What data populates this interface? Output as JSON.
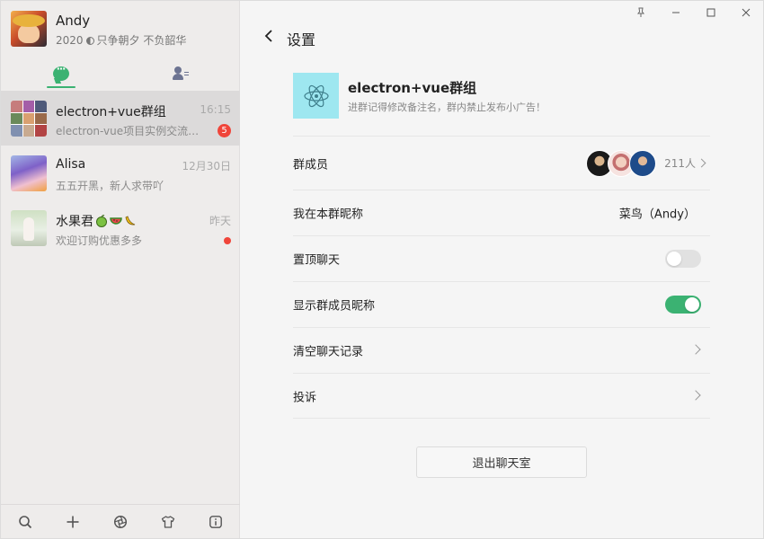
{
  "profile": {
    "name": "Andy",
    "motto_year": "2020",
    "motto_text": "只争朝夕 不负韶华"
  },
  "colors": {
    "accent": "#3bb272",
    "badge": "#f0453a",
    "group_logo_bg": "#9ee7f0"
  },
  "tabs": [
    {
      "icon": "chat-bubble-icon",
      "active": true
    },
    {
      "icon": "contacts-icon",
      "active": false
    }
  ],
  "chats": [
    {
      "title": "electron+vue群组",
      "preview": "electron-vue项目实例交流群…",
      "time": "16:15",
      "unread": "5",
      "active": true
    },
    {
      "title": "Alisa",
      "preview": "五五开黑，新人求带吖",
      "time": "12月30日"
    },
    {
      "title": "水果君",
      "preview": "欢迎订购优惠多多",
      "time": "昨天",
      "dot": true
    }
  ],
  "bottom_bar": [
    "search-icon",
    "plus-icon",
    "aperture-icon",
    "tshirt-icon",
    "info-icon"
  ],
  "window_controls": [
    "pin-icon",
    "minimize-icon",
    "maximize-icon",
    "close-icon"
  ],
  "header": {
    "title": "设置"
  },
  "group": {
    "name": "electron+vue群组",
    "notice": "进群记得修改备注名，群内禁止发布小广告！"
  },
  "settings": {
    "members": {
      "label": "群成员",
      "count": "211人"
    },
    "nickname": {
      "label": "我在本群昵称",
      "value": "菜鸟（Andy）"
    },
    "pin_chat": {
      "label": "置顶聊天",
      "on": false
    },
    "show_nicknames": {
      "label": "显示群成员昵称",
      "on": true
    },
    "clear_history": {
      "label": "清空聊天记录"
    },
    "report": {
      "label": "投诉"
    }
  },
  "exit_button": {
    "label": "退出聊天室"
  }
}
